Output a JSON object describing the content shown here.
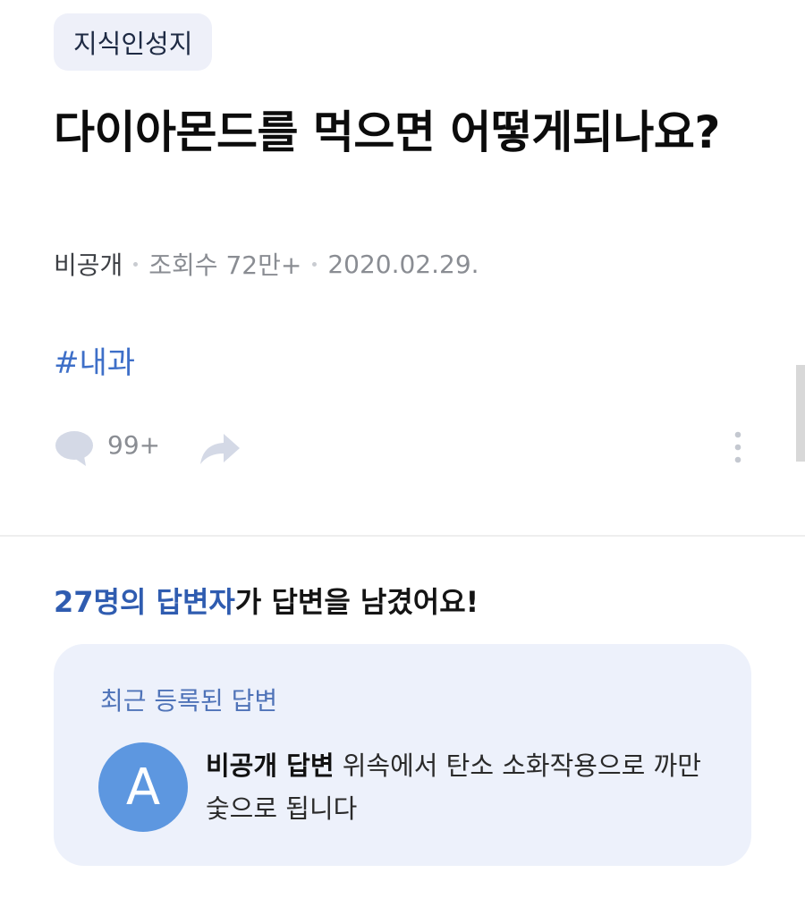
{
  "question": {
    "category": "지식인성지",
    "title": "다이아몬드를 먹으면 어떻게되나요?",
    "author": "비공개",
    "views": "조회수 72만+",
    "date": "2020.02.29.",
    "tag": "#내과"
  },
  "actions": {
    "comment_icon": "speech-bubble-icon",
    "comment_count": "99+",
    "share_icon": "share-arrow-icon",
    "more_icon": "vertical-dots-icon"
  },
  "answers": {
    "heading_highlight": "27명의 답변자",
    "heading_rest": "가 답변을 남겼어요!",
    "card_label": "최근 등록된 답변",
    "latest": {
      "avatar_letter": "A",
      "author": "비공개 답변",
      "text": "위속에서 탄소 소화작용으로 까만 숯으로 됩니다"
    }
  },
  "colors": {
    "accent_blue": "#3e6fc8",
    "card_background": "#edf1fb",
    "avatar_background": "#5d97e0",
    "category_background": "#eef0f9"
  }
}
